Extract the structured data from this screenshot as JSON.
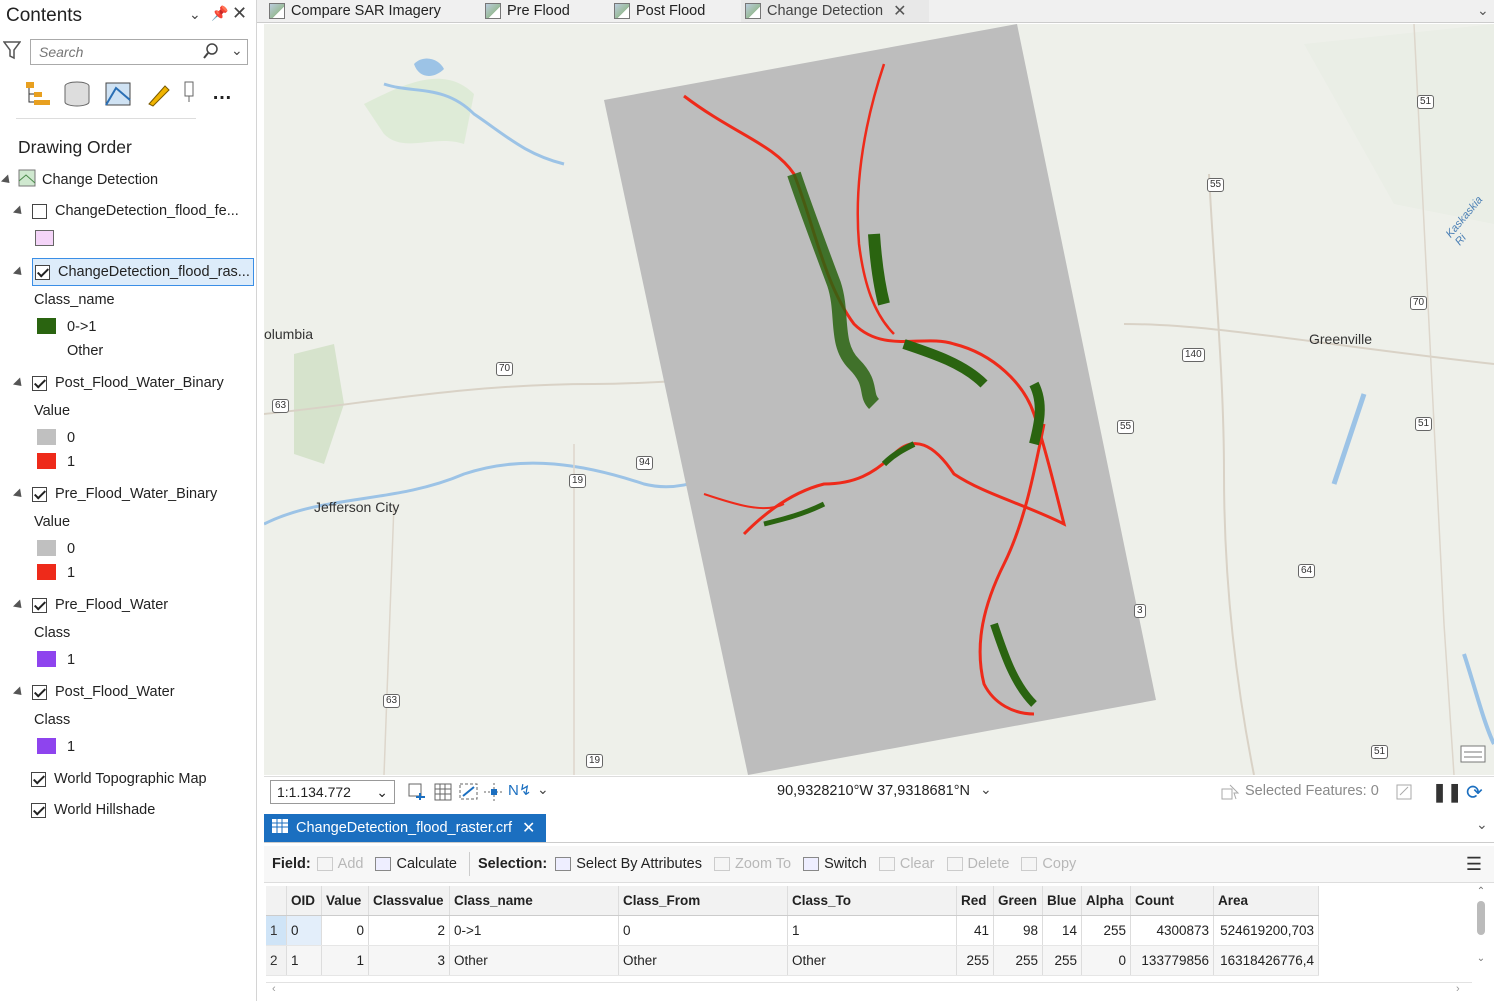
{
  "contents": {
    "title": "Contents",
    "search_placeholder": "Search",
    "drawing_order_label": "Drawing Order",
    "map_name": "Change Detection",
    "layers": [
      {
        "name": "ChangeDetection_flood_fe...",
        "checked": false
      },
      {
        "name": "ChangeDetection_flood_ras...",
        "checked": true,
        "selected": true,
        "field": "Class_name",
        "legend": [
          {
            "label": "0->1",
            "color": "#2a6410"
          },
          {
            "label": "Other",
            "color": "none"
          }
        ]
      },
      {
        "name": "Post_Flood_Water_Binary",
        "checked": true,
        "field": "Value",
        "legend": [
          {
            "label": "0",
            "color": "#c0c0c0"
          },
          {
            "label": "1",
            "color": "#ee2a1a"
          }
        ]
      },
      {
        "name": "Pre_Flood_Water_Binary",
        "checked": true,
        "field": "Value",
        "legend": [
          {
            "label": "0",
            "color": "#c0c0c0"
          },
          {
            "label": "1",
            "color": "#ee2a1a"
          }
        ]
      },
      {
        "name": "Pre_Flood_Water",
        "checked": true,
        "field": "Class",
        "legend": [
          {
            "label": "1",
            "color": "#8e44ee"
          }
        ]
      },
      {
        "name": "Post_Flood_Water",
        "checked": true,
        "field": "Class",
        "legend": [
          {
            "label": "1",
            "color": "#8e44ee"
          }
        ]
      },
      {
        "name": "World Topographic Map",
        "checked": true
      },
      {
        "name": "World Hillshade",
        "checked": true
      }
    ],
    "feature_swatch_color": "#f4d4f8"
  },
  "tabs": [
    {
      "label": "Compare SAR Imagery"
    },
    {
      "label": "Pre Flood"
    },
    {
      "label": "Post Flood"
    },
    {
      "label": "Change Detection",
      "active": true
    }
  ],
  "map": {
    "places": [
      "olumbia",
      "Jefferson City",
      "Greenville"
    ],
    "shields": [
      "51",
      "55",
      "70",
      "70",
      "140",
      "63",
      "94",
      "19",
      "55",
      "51",
      "64",
      "63",
      "19",
      "51",
      "3"
    ],
    "river_label": "Kaskaskia Ri",
    "raster_gray": "#bdbdbd",
    "water_red": "#ee2a1a",
    "change_green": "#2a6410"
  },
  "status": {
    "scale": "1:1.134.772",
    "coordinates": "90,9328210°W 37,9318681°N",
    "selected_features": "Selected Features: 0"
  },
  "table": {
    "tab_label": "ChangeDetection_flood_raster.crf",
    "toolbar": {
      "field_label": "Field:",
      "add": "Add",
      "calculate": "Calculate",
      "selection_label": "Selection:",
      "select_by_attributes": "Select By Attributes",
      "zoom_to": "Zoom To",
      "switch": "Switch",
      "clear": "Clear",
      "delete": "Delete",
      "copy": "Copy"
    },
    "columns": [
      "OID",
      "Value",
      "Classvalue",
      "Class_name",
      "Class_From",
      "Class_To",
      "Red",
      "Green",
      "Blue",
      "Alpha",
      "Count",
      "Area"
    ],
    "rows": [
      {
        "num": "1",
        "cells": [
          "0",
          "0",
          "2",
          "0->1",
          "0",
          "1",
          "41",
          "98",
          "14",
          "255",
          "4300873",
          "524619200,703"
        ]
      },
      {
        "num": "2",
        "cells": [
          "1",
          "1",
          "3",
          "Other",
          "Other",
          "Other",
          "255",
          "255",
          "255",
          "0",
          "133779856",
          "16318426776,4"
        ]
      }
    ]
  }
}
